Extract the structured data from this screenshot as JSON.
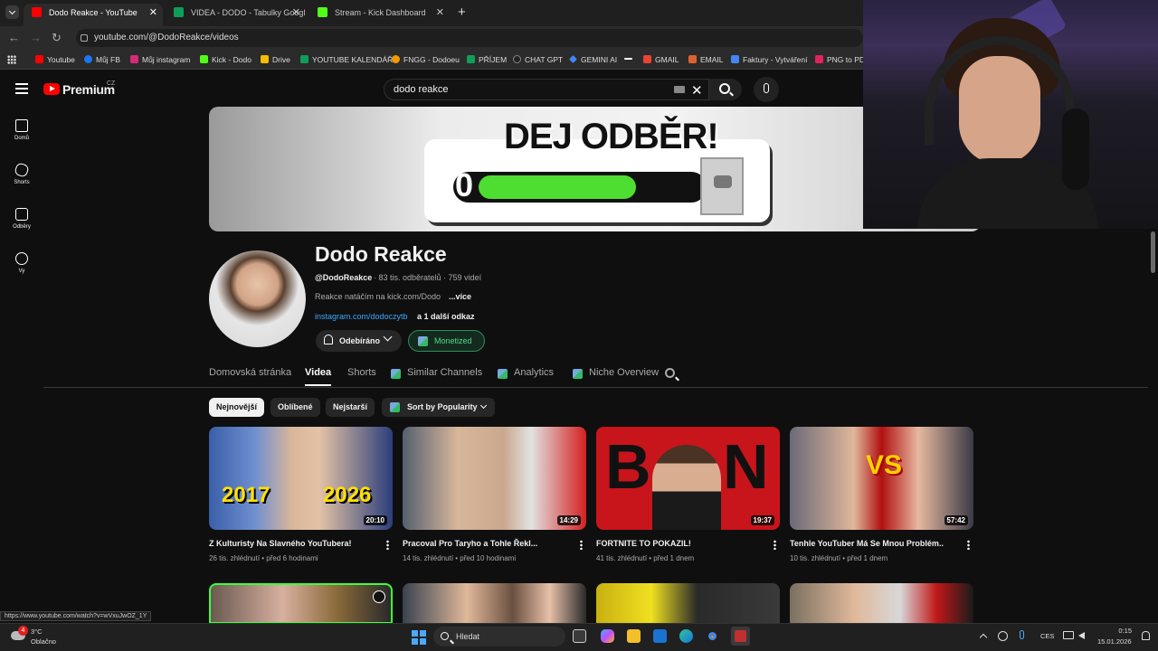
{
  "browser": {
    "tabs": [
      {
        "title": "Dodo Reakce - YouTube",
        "color": "#ff0000"
      },
      {
        "title": "VIDEA - DODO - Tabulky Googl",
        "color": "#0f9d58"
      },
      {
        "title": "Stream - Kick Dashboard",
        "color": "#53fc18"
      }
    ],
    "new_tab": "+",
    "url": "youtube.com/@DodoReakce/videos",
    "bookmarks": [
      {
        "label": "Youtube",
        "color": "#ff0000"
      },
      {
        "label": "Můj FB",
        "color": "#1877f2"
      },
      {
        "label": "Můj instagram",
        "color": "#d62976"
      },
      {
        "label": "Kick - Dodo",
        "color": "#53fc18"
      },
      {
        "label": "Drive",
        "color": "#fbbc04"
      },
      {
        "label": "YOUTUBE KALENDÁŘ",
        "color": "#0f9d58"
      },
      {
        "label": "FNGG - Dodoeu",
        "color": "#f29900"
      },
      {
        "label": "PŘÍJEM",
        "color": "#0f9d58"
      },
      {
        "label": "CHAT GPT",
        "color": "#222222"
      },
      {
        "label": "GEMINI AI",
        "color": "#4285f4"
      },
      {
        "label": "",
        "color": "#ffffff"
      },
      {
        "label": "GMAIL",
        "color": "#ea4335"
      },
      {
        "label": "EMAIL",
        "color": "#e06030"
      },
      {
        "label": "Faktury - Vytváření",
        "color": "#4285f4"
      },
      {
        "label": "PNG to PDF",
        "color": "#e0245e"
      }
    ]
  },
  "youtube": {
    "logo_text": "Premium",
    "logo_region": "CZ",
    "search_value": "dodo reakce",
    "sidebar": [
      {
        "label": "Domů",
        "icon": "home-icon"
      },
      {
        "label": "Shorts",
        "icon": "shorts-icon"
      },
      {
        "label": "Odběry",
        "icon": "subscriptions-icon"
      },
      {
        "label": "Vy",
        "icon": "you-icon"
      }
    ],
    "banner": {
      "title": "DEJ ODBĚR!",
      "counter": "0"
    },
    "channel": {
      "name": "Dodo Reakce",
      "handle": "@DodoReakce",
      "stats": "· 83 tis. odběratelů · 759 videí",
      "description": "Reakce natáčím na kick.com/Dodo",
      "more": "...více",
      "link": "instagram.com/dodoczytb",
      "link_more": "a 1 další odkaz",
      "subscribe_label": "Odebíráno",
      "monetized_label": "Monetized"
    },
    "tabs": [
      "Domovská stránka",
      "Videa",
      "Shorts",
      "Similar Channels",
      "Analytics",
      "Niche Overview"
    ],
    "active_tab": "Videa",
    "chips": [
      "Nejnovější",
      "Oblíbené",
      "Nejstarší",
      "Sort by Popularity"
    ],
    "videos": [
      {
        "title": "Z Kulturisty Na Slavného YouTubera!",
        "views": "26 tis. zhlédnutí",
        "age": "před 6 hodinami",
        "duration": "20:10",
        "thumb_text_left": "2017",
        "thumb_text_right": "2026"
      },
      {
        "title": "Pracoval Pro Taryho a Tohle Řekl...",
        "views": "14 tis. zhlédnutí",
        "age": "před 10 hodinami",
        "duration": "14:29"
      },
      {
        "title": "FORTNITE TO POKAZIL!",
        "views": "41 tis. zhlédnutí",
        "age": "před 1 dnem",
        "duration": "19:37",
        "thumb_text_left": "B",
        "thumb_text_right": "N"
      },
      {
        "title": "Tenhle YouTuber Má Se Mnou Problém..",
        "views": "10 tis. zhlédnutí",
        "age": "před 1 dnem",
        "duration": "57:42",
        "thumb_text_left": "VS"
      }
    ],
    "status_url": "https://www.youtube.com/watch?v=wVxuJwOZ_1Y"
  },
  "taskbar": {
    "weather_badge": "4",
    "weather_temp": "3°C",
    "weather_desc": "Oblačno",
    "search_placeholder": "Hledat",
    "lang": "CES",
    "time": "0:15",
    "date": "15.01.2026"
  }
}
